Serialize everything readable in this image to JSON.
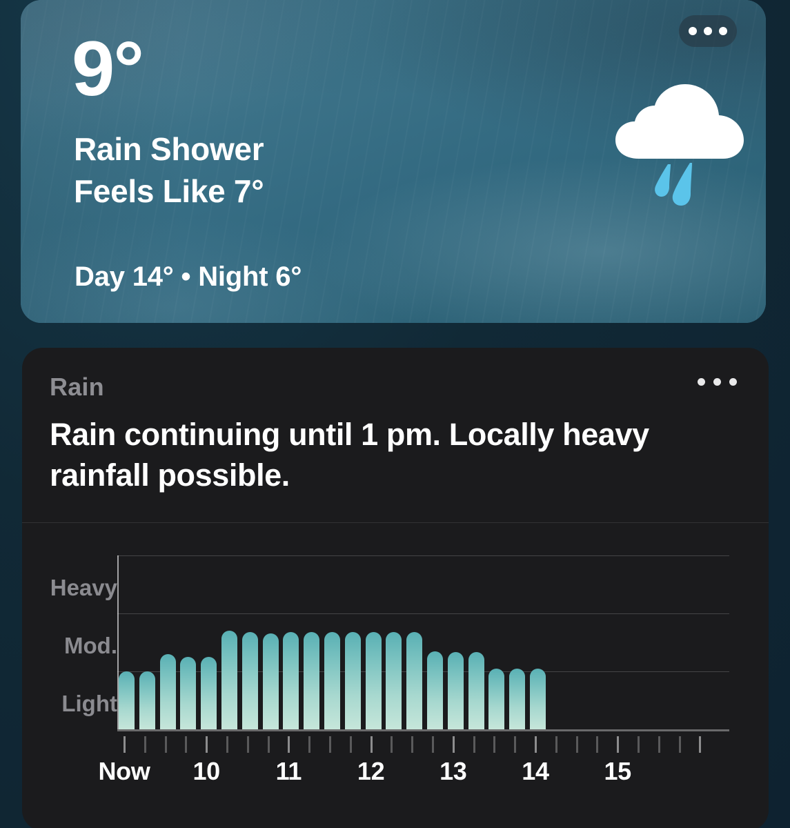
{
  "page": {
    "background_color": "#112a37"
  },
  "hero_card": {
    "temperature": "9°",
    "condition": "Rain Shower",
    "feels_like": "Feels Like 7°",
    "day_night": "Day 14° • Night 6°",
    "icon": "rain-shower-cloud-icon",
    "menu_icon": "overflow-menu-icon",
    "background_color": "#3c7387",
    "text_color": "#ffffff"
  },
  "rain_card": {
    "kicker": "Rain",
    "headline": "Rain continuing until 1 pm. Locally heavy rainfall possible.",
    "menu_icon": "overflow-menu-icon",
    "background_color": "#1b1b1d",
    "kicker_color": "#8e8e93"
  },
  "chart_data": {
    "type": "bar",
    "title": "Rain",
    "xlabel": "",
    "ylabel": "",
    "grid": true,
    "legend": null,
    "y_categories": [
      "Light",
      "Mod.",
      "Heavy"
    ],
    "y_tick_labels": [
      "Light",
      "Mod.",
      "Heavy"
    ],
    "ylim": [
      0,
      3
    ],
    "bar_color_top": "#59b0b4",
    "bar_color_bottom": "#c6e6da",
    "x_tick_labels": [
      "Now",
      "10",
      "11",
      "12",
      "13",
      "14",
      "15"
    ],
    "x_tick_count": 29,
    "categories": [
      "Now",
      "t1",
      "t2",
      "t3",
      "t4",
      "t5",
      "t6",
      "t7",
      "t8",
      "t9",
      "t10",
      "t11",
      "t12",
      "t13",
      "t14",
      "t15",
      "t16",
      "t17",
      "t18",
      "t19",
      "t20"
    ],
    "values": [
      1.0,
      1.0,
      1.3,
      1.25,
      1.25,
      1.7,
      1.68,
      1.65,
      1.68,
      1.68,
      1.68,
      1.68,
      1.68,
      1.68,
      1.68,
      1.35,
      1.33,
      1.33,
      1.05,
      1.05,
      1.05
    ],
    "values_note": "Rain intensity; 1.0 = Light gridline, 2.0 = Mod. gridline, 3.0 = Heavy gridline"
  }
}
